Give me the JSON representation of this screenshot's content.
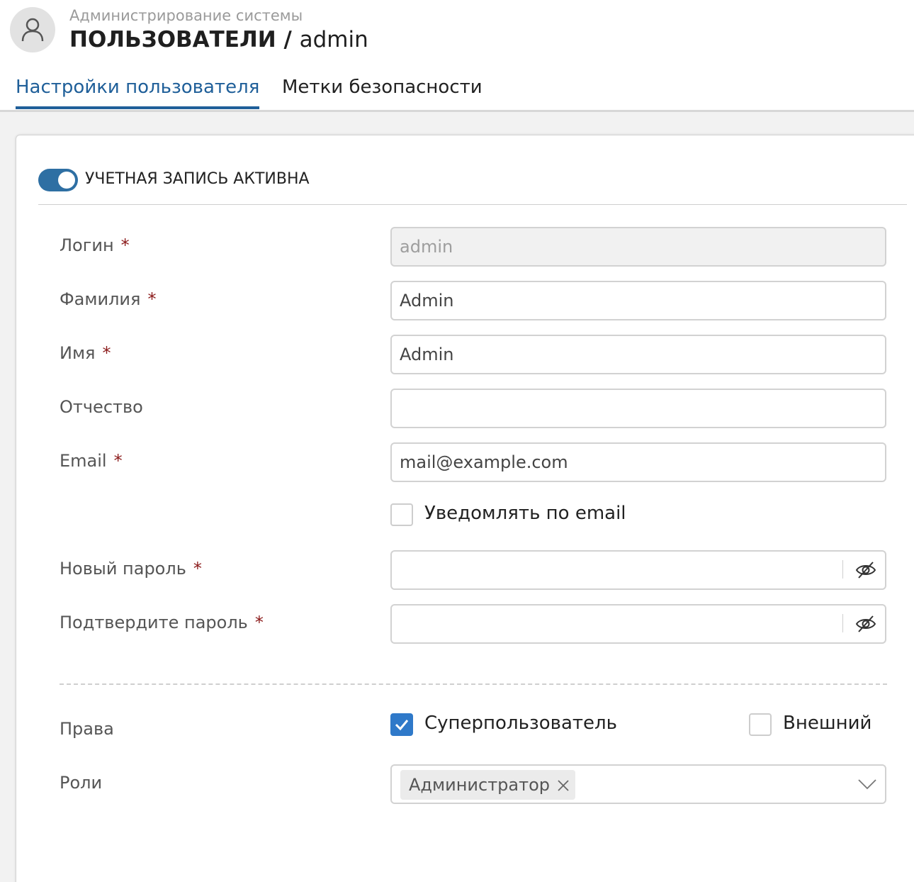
{
  "header": {
    "subtitle": "Администрирование системы",
    "title_section": "ПОЛЬЗОВАТЕЛИ",
    "title_separator": " / ",
    "title_user": "admin"
  },
  "tabs": [
    {
      "label": "Настройки пользователя",
      "active": true
    },
    {
      "label": "Метки безопасности",
      "active": false
    }
  ],
  "account": {
    "active_label": "УЧЕТНАЯ ЗАПИСЬ АКТИВНА",
    "active": true
  },
  "form": {
    "required_mark": "*",
    "login": {
      "label": "Логин",
      "value": "admin",
      "required": true,
      "disabled": true
    },
    "last_name": {
      "label": "Фамилия",
      "value": "Admin",
      "required": true
    },
    "first_name": {
      "label": "Имя",
      "value": "Admin",
      "required": true
    },
    "patronymic": {
      "label": "Отчество",
      "value": "",
      "required": false
    },
    "email": {
      "label": "Email",
      "value": "mail@example.com",
      "required": true
    },
    "notify_email": {
      "label": "Уведомлять по email",
      "checked": false
    },
    "new_password": {
      "label": "Новый пароль",
      "value": "",
      "required": true,
      "icon": "eye-slash-icon"
    },
    "confirm_password": {
      "label": "Подтвердите пароль",
      "value": "",
      "required": true,
      "icon": "eye-slash-icon"
    }
  },
  "rights": {
    "label": "Права",
    "superuser": {
      "label": "Суперпользователь",
      "checked": true
    },
    "external": {
      "label": "Внешний",
      "checked": false
    }
  },
  "roles": {
    "label": "Роли",
    "selected": [
      "Администратор"
    ]
  },
  "colors": {
    "accent": "#1f5f99",
    "toggle": "#2e6fa3",
    "checkbox": "#2f79c9",
    "required": "#8b1a1a"
  }
}
